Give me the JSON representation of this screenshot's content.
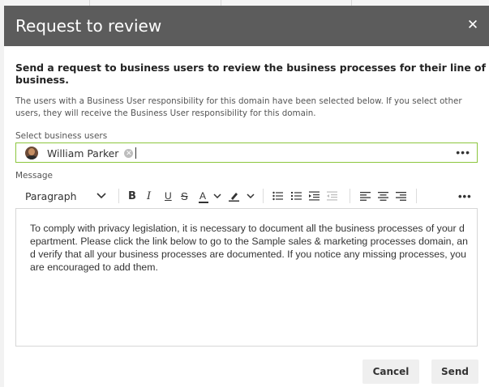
{
  "dialog": {
    "title": "Request to review",
    "close_icon": "close-icon",
    "heading": "Send a request to business users to review the business processes for their line of business.",
    "description": "The users with a Business User responsibility for this domain have been selected below. If you select other users, they will receive the Business User responsibility for this domain."
  },
  "users": {
    "label": "Select business users",
    "selected": [
      {
        "name": "William Parker",
        "avatar_icon": "user-avatar",
        "remove_icon": "remove-chip-icon"
      }
    ],
    "more_icon": "more-options-icon",
    "more_glyph": "•••"
  },
  "message": {
    "label": "Message",
    "toolbar": {
      "block_format": "Paragraph",
      "buttons": [
        "bold-icon",
        "italic-icon",
        "underline-icon",
        "strikethrough-icon",
        "font-color-icon",
        "highlight-color-icon",
        "bulleted-list-icon",
        "numbered-list-icon",
        "increase-indent-icon",
        "decrease-indent-icon",
        "align-left-icon",
        "align-center-icon",
        "align-right-icon",
        "more-options-icon"
      ]
    },
    "body": "To comply with privacy legislation, it is necessary to document all the business processes of your department. Please click the link below to go to the Sample sales & marketing processes domain, and verify that all your business processes are documented. If you notice any missing processes, you are encouraged to add them."
  },
  "actions": {
    "cancel": "Cancel",
    "send": "Send"
  },
  "colors": {
    "header_bg": "#5c5c5c",
    "field_focus_border": "#8cc63e",
    "button_bg": "#efefef"
  }
}
